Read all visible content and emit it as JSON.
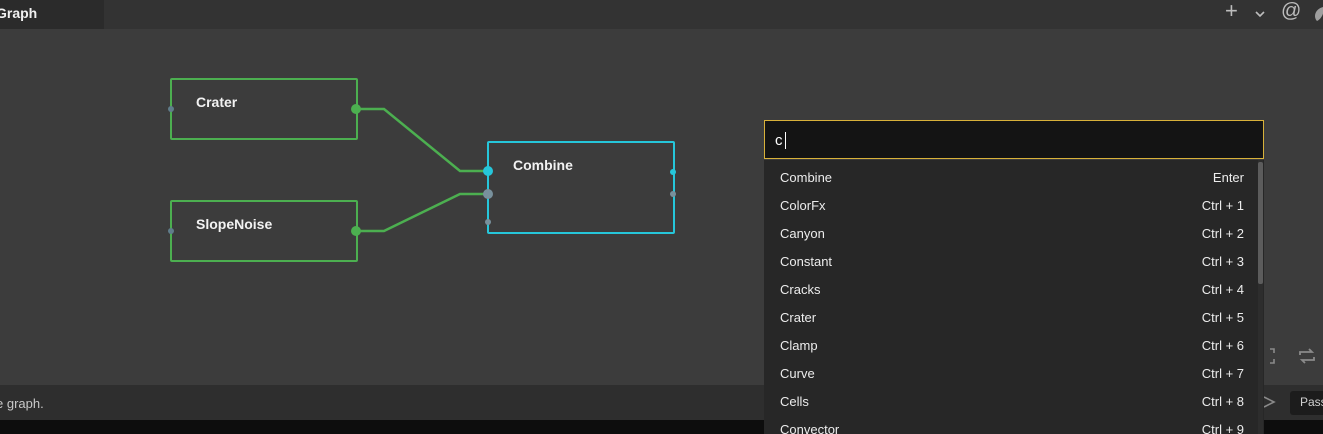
{
  "header": {
    "tab_title": "Graph",
    "icons": [
      "plus-icon",
      "chevron-down-icon",
      "at-icon",
      "leaf-icon"
    ]
  },
  "graph": {
    "nodes": [
      {
        "id": "crater",
        "label": "Crater",
        "color": "#4caf50"
      },
      {
        "id": "slopenoise",
        "label": "SlopeNoise",
        "color": "#4caf50"
      },
      {
        "id": "combine",
        "label": "Combine",
        "color": "#26c6da"
      }
    ]
  },
  "search": {
    "value": "c",
    "accent_color": "#d8b13a",
    "results": [
      {
        "name": "Combine",
        "shortcut": "Enter"
      },
      {
        "name": "ColorFx",
        "shortcut": "Ctrl + 1"
      },
      {
        "name": "Canyon",
        "shortcut": "Ctrl + 2"
      },
      {
        "name": "Constant",
        "shortcut": "Ctrl + 3"
      },
      {
        "name": "Cracks",
        "shortcut": "Ctrl + 4"
      },
      {
        "name": "Crater",
        "shortcut": "Ctrl + 5"
      },
      {
        "name": "Clamp",
        "shortcut": "Ctrl + 6"
      },
      {
        "name": "Curve",
        "shortcut": "Ctrl + 7"
      },
      {
        "name": "Cells",
        "shortcut": "Ctrl + 8"
      },
      {
        "name": "Convector",
        "shortcut": "Ctrl + 9"
      }
    ]
  },
  "status": {
    "text": "e graph.",
    "pass_label": "Pass"
  }
}
